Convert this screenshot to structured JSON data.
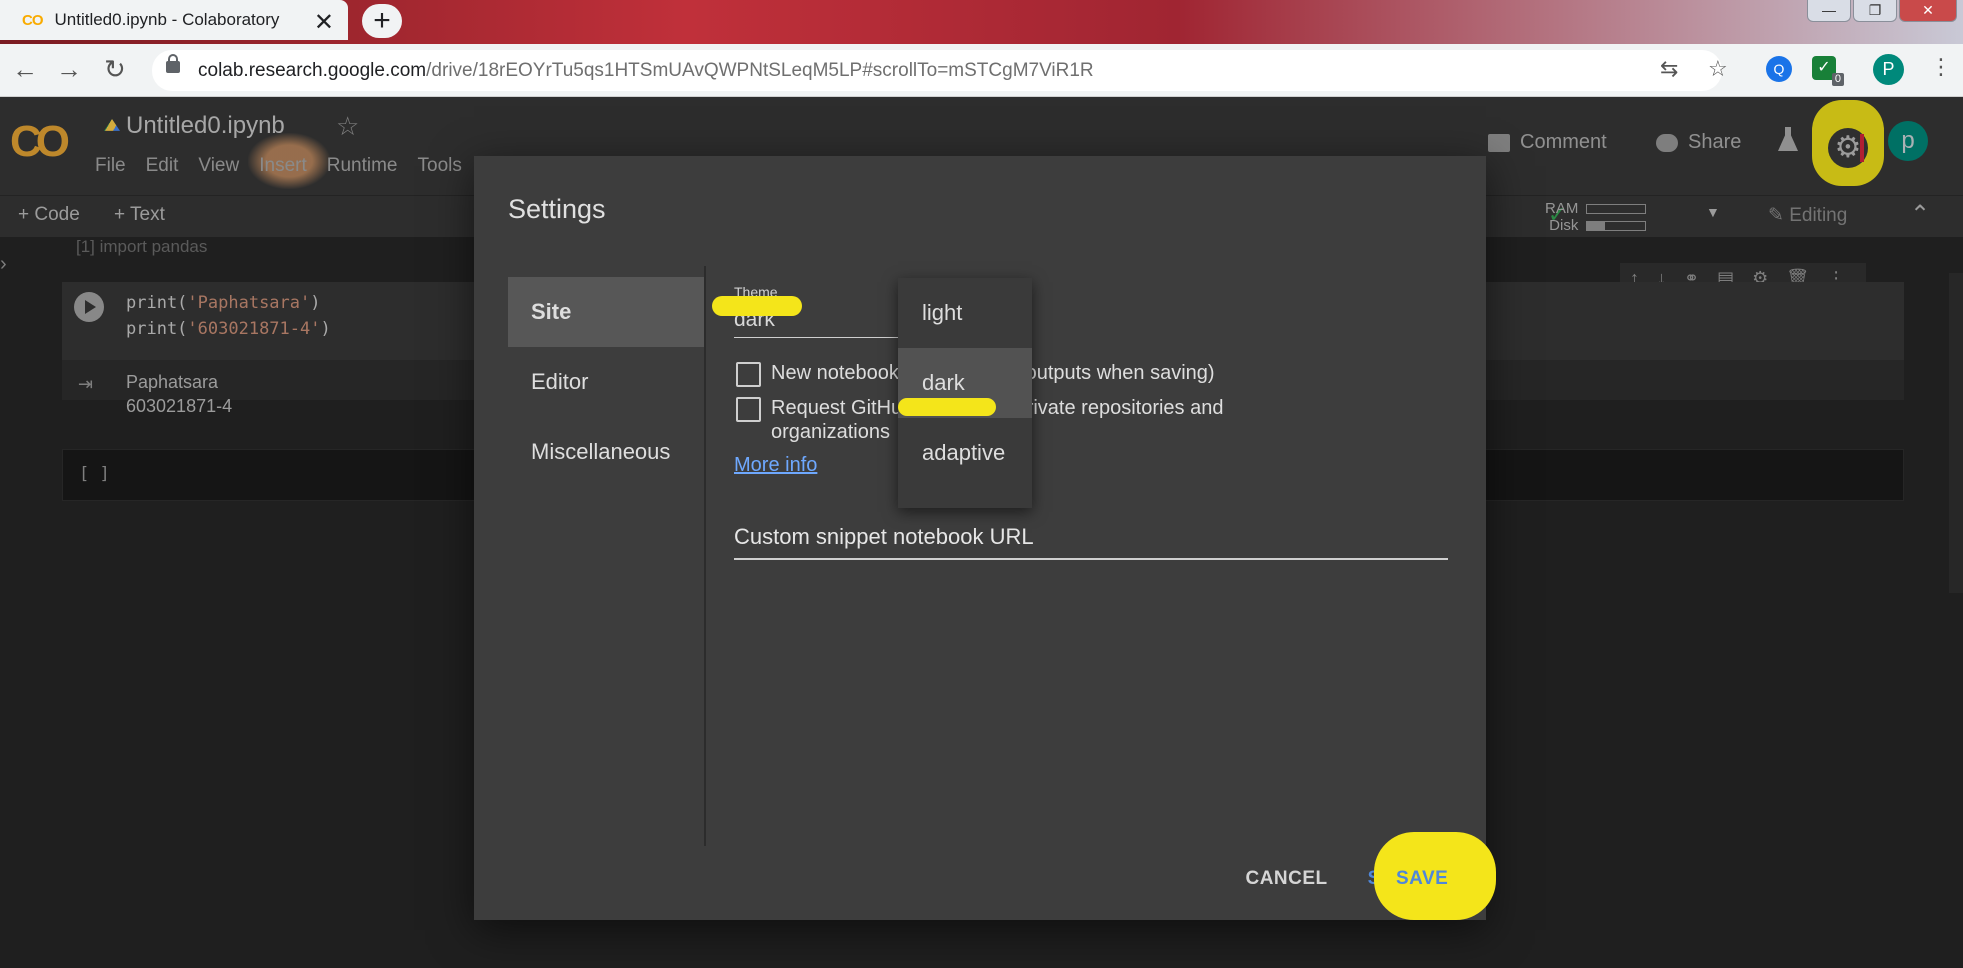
{
  "browser": {
    "tab_title": "Untitled0.ipynb - Colaboratory",
    "tab_favicon": "CO",
    "tab_close": "✕",
    "new_tab": "+",
    "url_host": "colab.research.google.com",
    "url_path": "/drive/18rEOYrTu5qs1HTSmUAvQWPNtSLeqM5LP#scrollTo=mSTCgM7ViR1R",
    "extension_badge": "0",
    "profile_initial": "P"
  },
  "colab": {
    "logo": "CO",
    "notebook_title": "Untitled0.ipynb",
    "menu": [
      "File",
      "Edit",
      "View",
      "Insert",
      "Runtime",
      "Tools"
    ],
    "comment_label": "Comment",
    "share_label": "Share",
    "avatar_initial": "p",
    "add_code": "+ Code",
    "add_text": "+ Text",
    "ram_label": "RAM",
    "disk_label": "Disk",
    "ram_usage": 0,
    "disk_usage": 0.3,
    "editing_label": "Editing"
  },
  "notebook": {
    "prev_cell_text": "[1]   import  pandas",
    "code_lines": [
      {
        "fn": "print(",
        "str": "'Paphatsara'",
        "end": ")"
      },
      {
        "fn": "print(",
        "str": "'603021871-4'",
        "end": ")"
      }
    ],
    "output_lines": [
      "Paphatsara",
      "603021871-4"
    ],
    "empty_cell_prompt": "[ ]"
  },
  "dialog": {
    "title": "Settings",
    "nav": [
      "Site",
      "Editor",
      "Miscellaneous"
    ],
    "theme_label": "Theme",
    "theme_value": "dark",
    "checkbox1": "New notebook           outputs (omit outputs when saving)",
    "checkbox2": "Request GitHu            ew and edit private repositories and organizations",
    "more_info": "More info",
    "snippet_label": "Custom snippet notebook URL",
    "theme_options": [
      "light",
      "dark",
      "adaptive"
    ],
    "selected_option": "dark",
    "cancel": "CANCEL",
    "save": "SAVE"
  },
  "colors": {
    "highlight": "#f4e51a",
    "accent_blue": "#4f87d9",
    "dialog_bg": "#3d3d3d"
  }
}
